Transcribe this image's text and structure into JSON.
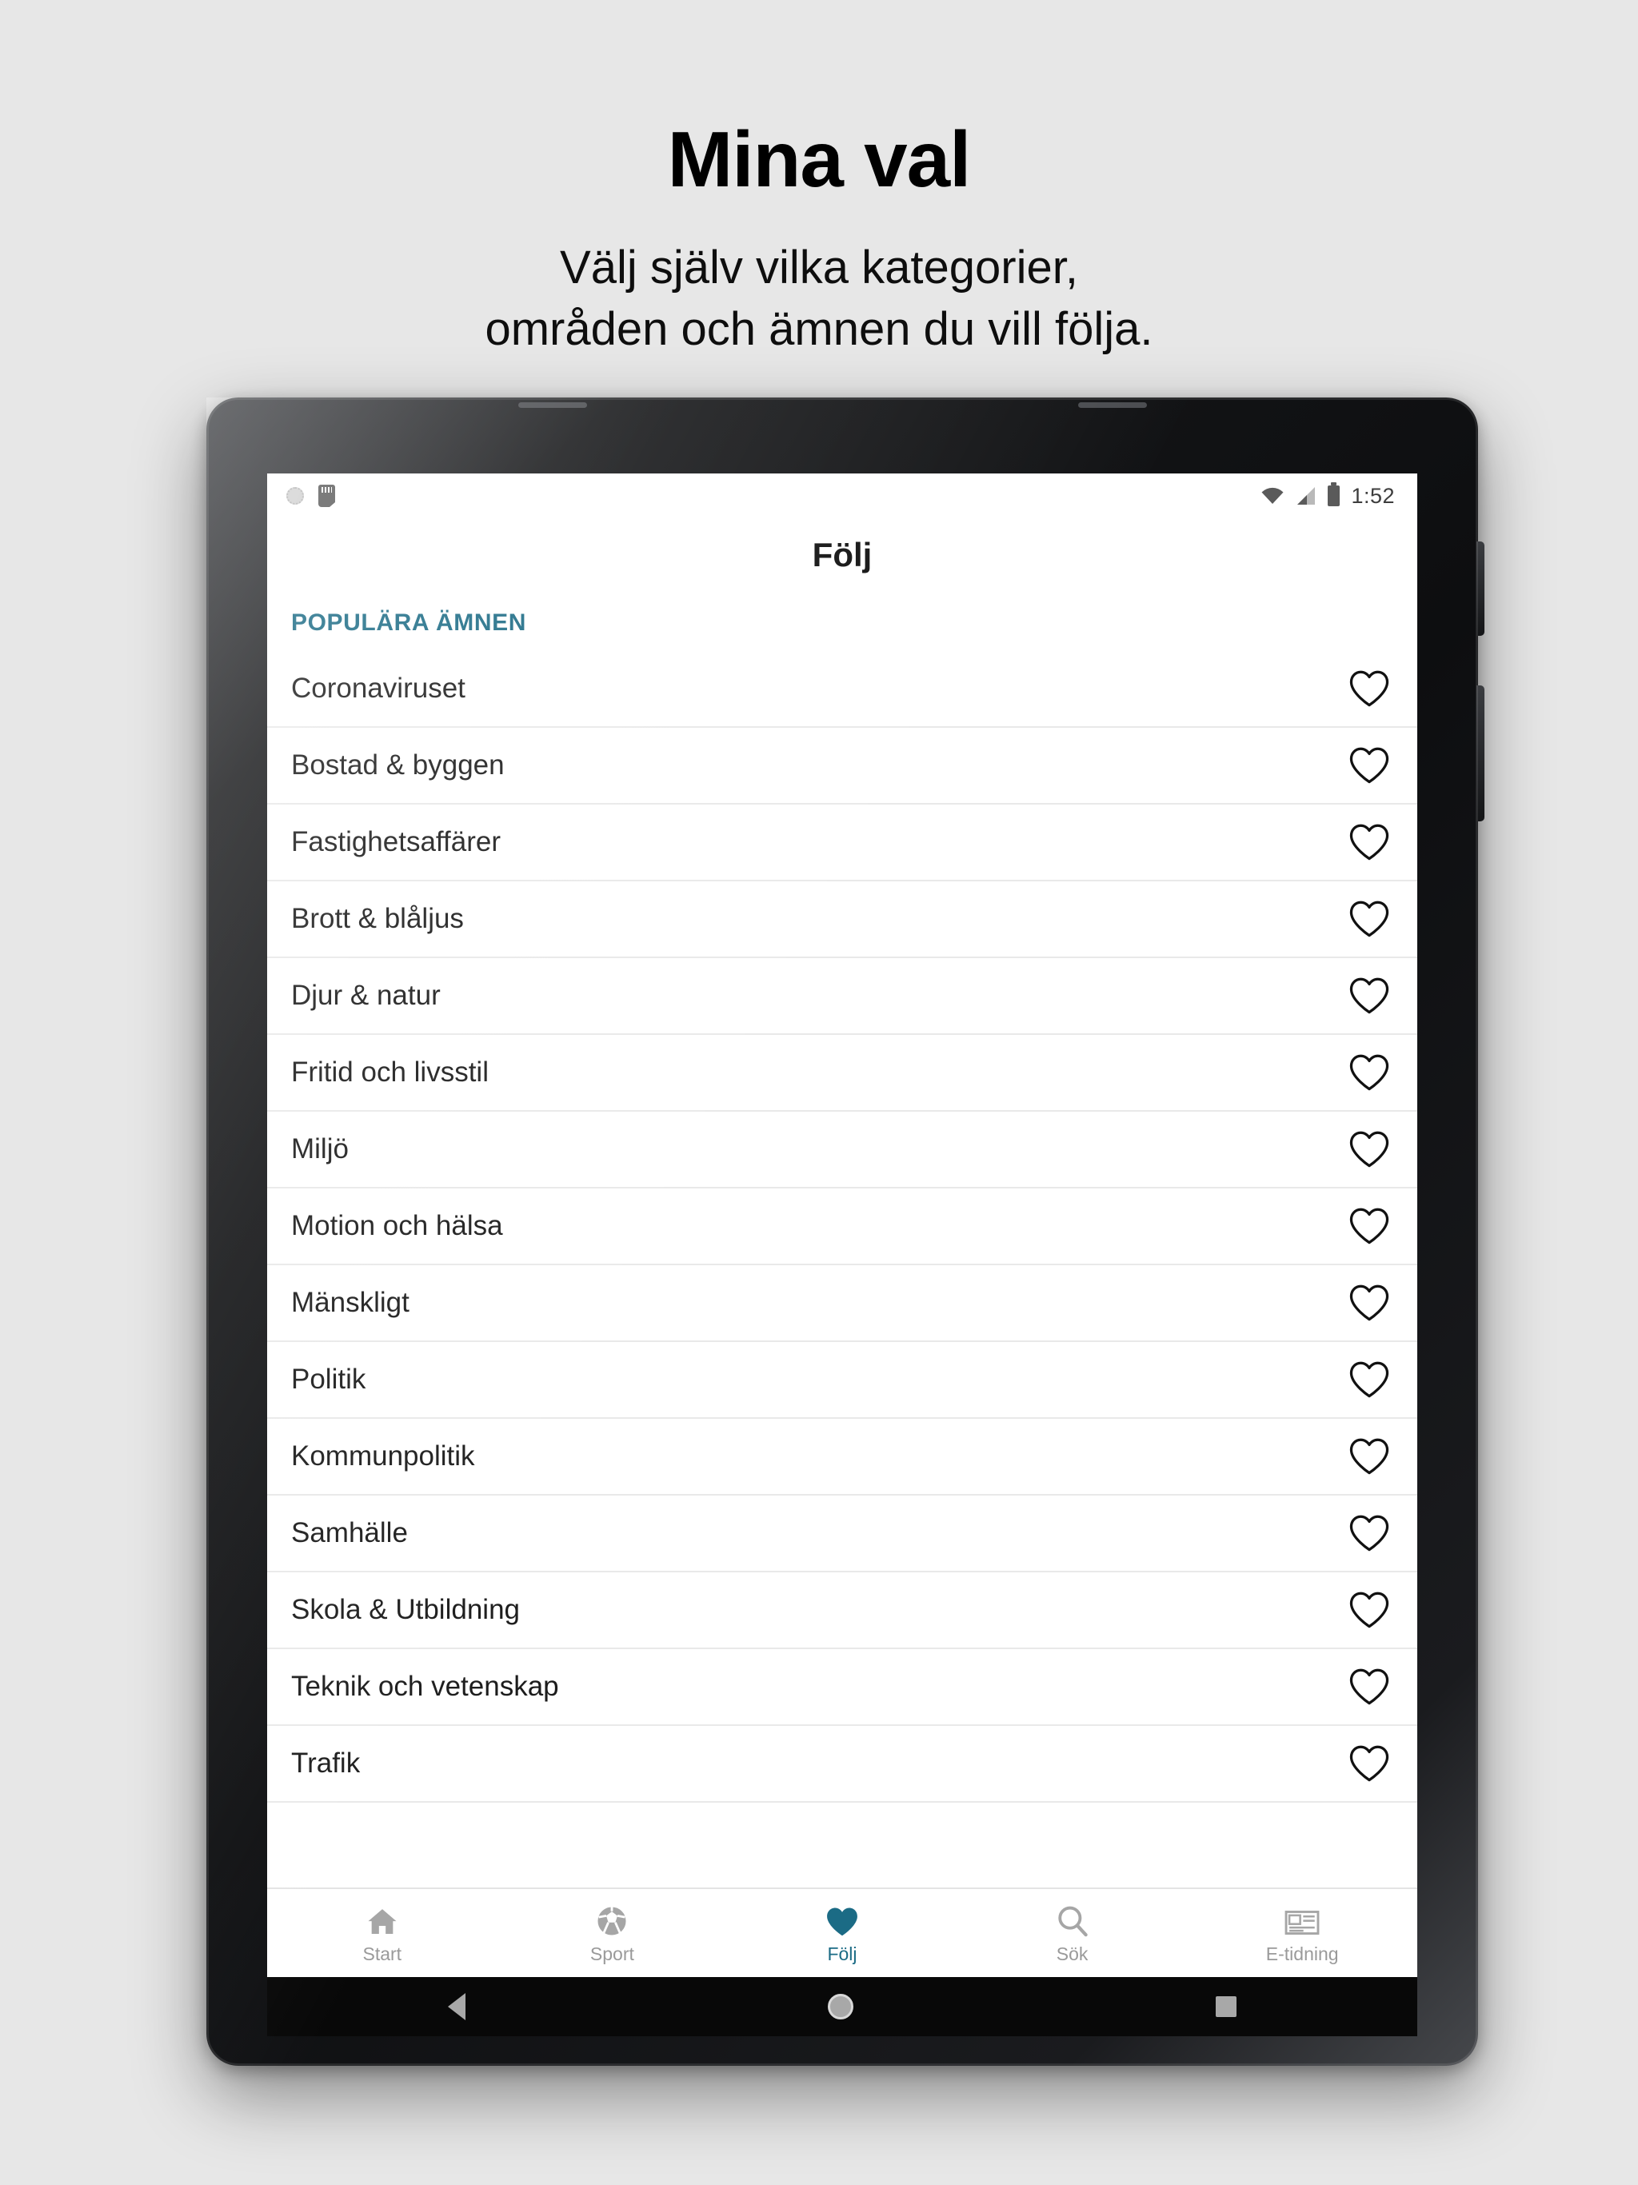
{
  "promo": {
    "title": "Mina val",
    "subtitle_line1": "Välj själv vilka kategorier,",
    "subtitle_line2": "områden och ämnen du vill följa."
  },
  "statusbar": {
    "time": "1:52",
    "icons_left": [
      "nfc-icon",
      "sim-card-icon"
    ],
    "icons_right": [
      "wifi-icon",
      "cellular-signal-icon",
      "battery-icon"
    ]
  },
  "appbar": {
    "title": "Följ"
  },
  "content": {
    "section_title": "POPULÄRA ÄMNEN",
    "accent_color": "#1b6b85",
    "topics": [
      {
        "label": "Coronaviruset",
        "followed": false
      },
      {
        "label": "Bostad & byggen",
        "followed": false
      },
      {
        "label": "Fastighetsaffärer",
        "followed": false
      },
      {
        "label": "Brott & blåljus",
        "followed": false
      },
      {
        "label": "Djur & natur",
        "followed": false
      },
      {
        "label": "Fritid och livsstil",
        "followed": false
      },
      {
        "label": "Miljö",
        "followed": false
      },
      {
        "label": "Motion och hälsa",
        "followed": false
      },
      {
        "label": "Mänskligt",
        "followed": false
      },
      {
        "label": "Politik",
        "followed": false
      },
      {
        "label": "Kommunpolitik",
        "followed": false
      },
      {
        "label": "Samhälle",
        "followed": false
      },
      {
        "label": "Skola & Utbildning",
        "followed": false
      },
      {
        "label": "Teknik och vetenskap",
        "followed": false
      },
      {
        "label": "Trafik",
        "followed": false
      }
    ]
  },
  "tabbar": {
    "tabs": [
      {
        "label": "Start",
        "icon": "home-icon",
        "active": false
      },
      {
        "label": "Sport",
        "icon": "soccer-ball-icon",
        "active": false
      },
      {
        "label": "Följ",
        "icon": "heart-icon",
        "active": true
      },
      {
        "label": "Sök",
        "icon": "search-icon",
        "active": false
      },
      {
        "label": "E-tidning",
        "icon": "newspaper-icon",
        "active": false
      }
    ]
  },
  "android_nav": {
    "back": "back-triangle-icon",
    "home": "home-circle-icon",
    "recent": "recent-apps-square-icon"
  }
}
